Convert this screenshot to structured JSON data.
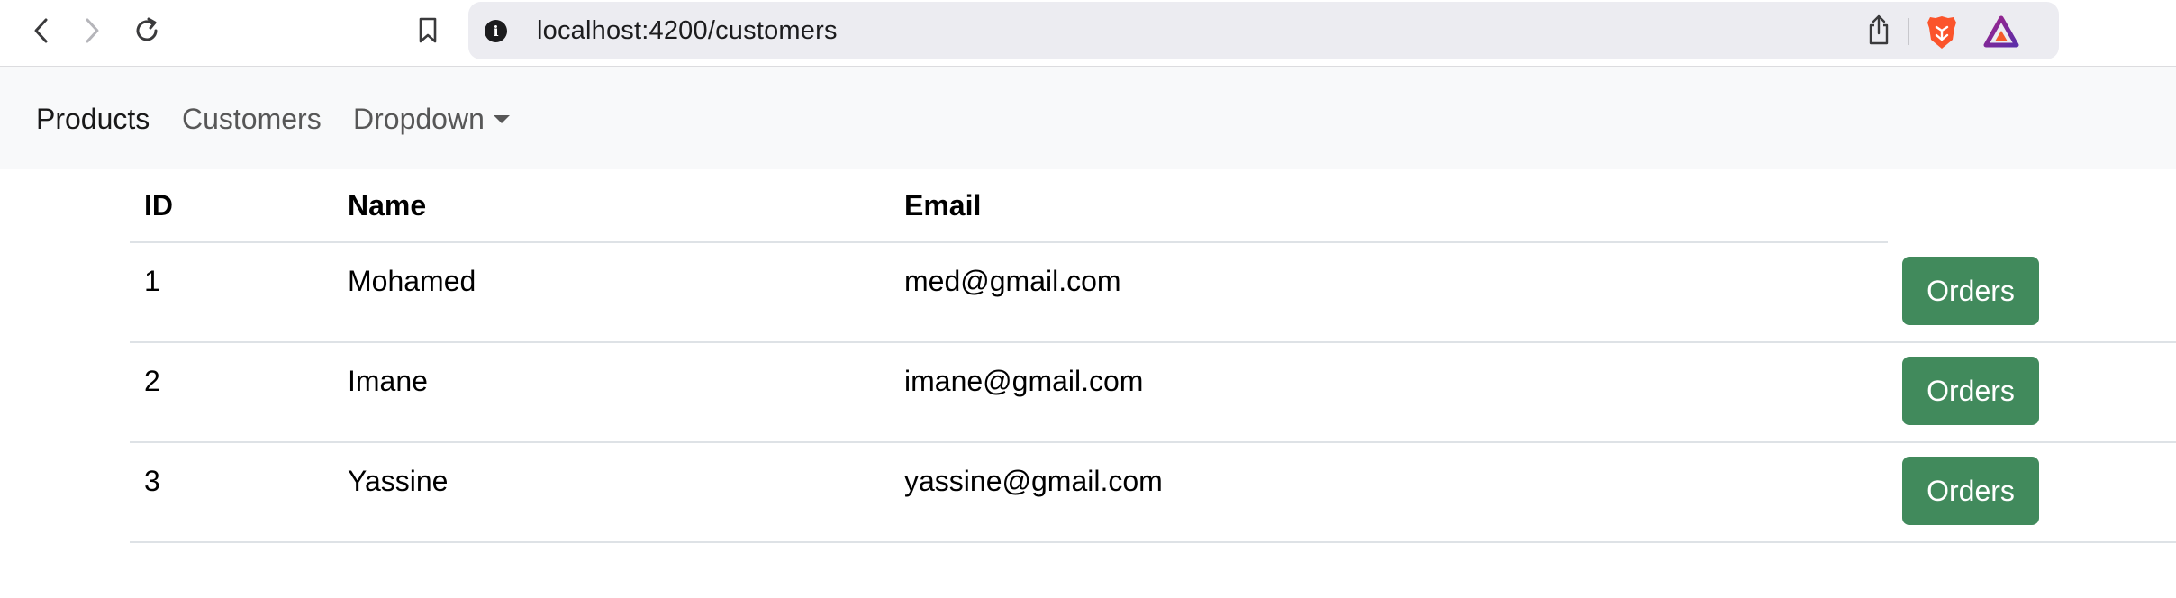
{
  "browser": {
    "url": "localhost:4200/customers",
    "icons": {
      "back": "chevron-left-icon",
      "forward": "chevron-right-icon",
      "reload": "reload-icon",
      "bookmark": "bookmark-icon",
      "info": "info-icon",
      "share": "share-icon",
      "brave": "brave-shields-icon",
      "rewards": "brave-rewards-icon"
    },
    "info_glyph": "i"
  },
  "navbar": {
    "items": [
      {
        "label": "Products",
        "active": true
      },
      {
        "label": "Customers",
        "active": false
      },
      {
        "label": "Dropdown",
        "active": false
      }
    ]
  },
  "table": {
    "headers": [
      "ID",
      "Name",
      "Email"
    ],
    "rows": [
      {
        "id": "1",
        "name": "Mohamed",
        "email": "med@gmail.com",
        "action": "Orders"
      },
      {
        "id": "2",
        "name": "Imane",
        "email": "imane@gmail.com",
        "action": "Orders"
      },
      {
        "id": "3",
        "name": "Yassine",
        "email": "yassine@gmail.com",
        "action": "Orders"
      }
    ]
  },
  "colors": {
    "navbar_bg": "#f8f9fa",
    "button_success": "#418a5c",
    "address_bar_bg": "#ececf1",
    "brave_orange": "#fb542b",
    "rewards_purple": "#6a2ea8"
  }
}
